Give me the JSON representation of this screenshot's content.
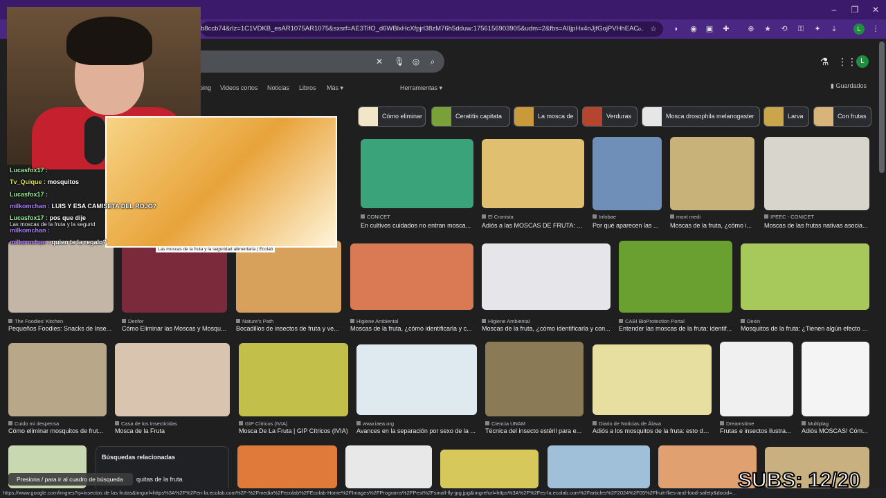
{
  "browser": {
    "url": "b8ccb74&rlz=1C1VDKB_esAR1075AR1075&sxsrf=AE3TifO_d6WBlxHcXfpjrl38zM76h5dduw:1756156903905&udm=2&fbs=AIIjpHx4nJjfGojPVHhEAC...",
    "status_url": "https://www.google.com/imgres?q=insectos de las frutas&imgurl=https%3A%2F%2Fen-la.ecolab.com%2F-%2Fmedia%2Fecolab%2FEcolab-Home%2FImages%2FPrograms%2FPest%2Fsmall-fly-jpg.jpg&imgrefurl=https%3A%2F%2Fes-la.ecolab.com%2Farticles%2F2024%2F05%2Ffruit-flies-and-food-safety&docid=...",
    "profile_letter": "L"
  },
  "google": {
    "avatar_letter": "L",
    "tabs": [
      "ping",
      "Videos cortos",
      "Noticias",
      "Libros",
      "Más ▾",
      "Herramientas ▾"
    ],
    "saved_label": "Guardados"
  },
  "chips": [
    {
      "label": "Cómo eliminar",
      "color": "#f1e7c8"
    },
    {
      "label": "Ceratitis capitata",
      "color": "#7aa03a"
    },
    {
      "label": "La mosca de",
      "color": "#c99a3b"
    },
    {
      "label": "Verduras",
      "color": "#b5452f"
    },
    {
      "label": "Mosca drosophila melanogaster",
      "color": "#e6e6e6"
    },
    {
      "label": "Larva",
      "color": "#caa54a"
    },
    {
      "label": "Con frutas",
      "color": "#d9b47a"
    }
  ],
  "results": [
    {
      "source": "CONICET",
      "title": "En cultivos cuidados no entran mosca...",
      "color": "#3aa37a"
    },
    {
      "source": "El Cronista",
      "title": "Adiós a las MOSCAS DE FRUTA: ...",
      "color": "#e0c070"
    },
    {
      "source": "Infobae",
      "title": "Por qué aparecen las ...",
      "color": "#6f8fb8"
    },
    {
      "source": "mont medi",
      "title": "Moscas de la fruta, ¿cómo i...",
      "color": "#c9b27a"
    },
    {
      "source": "IPEEC - CONICET",
      "title": "Moscas de las frutas nativas asocia...",
      "color": "#d8d6cc"
    },
    {
      "source": "The Foodies' Kitchen",
      "title": "Pequeños Foodies: Snacks de Inse...",
      "color": "#c4b6a6"
    },
    {
      "source": "Denfor",
      "title": "Cómo Eliminar las Moscas y Mosqu...",
      "color": "#7a2a3a"
    },
    {
      "source": "Nature's Path",
      "title": "Bocadillos de insectos de fruta y ve...",
      "color": "#d7a15b"
    },
    {
      "source": "Higiene Ambiental",
      "title": "Moscas de la fruta, ¿cómo identificarla y c...",
      "color": "#d97a55"
    },
    {
      "source": "Higiene Ambiental",
      "title": "Moscas de la fruta, ¿cómo identificarla y con...",
      "color": "#e6e6ea"
    },
    {
      "source": "CABI BioProtection Portal",
      "title": "Entender las moscas de la fruta: identif...",
      "color": "#6aa030"
    },
    {
      "source": "Dexin",
      "title": "Mosquitos de la fruta: ¿Tienen algún efecto s...",
      "color": "#a7c85a"
    },
    {
      "source": "Cuido mi despensa",
      "title": "Cómo eliminar mosquitos de frut...",
      "color": "#b9a78a"
    },
    {
      "source": "Casa de los Insecticidas",
      "title": "Mosca de la Fruta",
      "color": "#d9c4b0"
    },
    {
      "source": "GIP Cítricos (IVIA)",
      "title": "Mosca De La Fruta | GIP Cítricos (IVIA)",
      "color": "#c2c04a"
    },
    {
      "source": "www.iaea.org",
      "title": "Avances en la separación por sexo de la ...",
      "color": "#dfeaf0"
    },
    {
      "source": "Ciencia UNAM",
      "title": "Técnica del insecto estéril para e...",
      "color": "#8a7a55"
    },
    {
      "source": "Diario de Noticias de Álava",
      "title": "Adiós a los mosquitos de la fruta: esto de...",
      "color": "#e6dfa0"
    },
    {
      "source": "Dreamstime",
      "title": "Frutas e insectos ilustra...",
      "color": "#f0f0f0"
    },
    {
      "source": "Multiplag",
      "title": "Adiós MOSCAS! Cóm...",
      "color": "#f4f4f4"
    }
  ],
  "related": {
    "title": "Búsquedas relacionadas",
    "item": "quitas de la fruta"
  },
  "overlay": {
    "preview_caption": "Las moscas de la fruta y la seguridad alimentaria | Ecolab",
    "chat": [
      {
        "user": "Lucasfox17 :",
        "msg": ""
      },
      {
        "user": "Tv_Quique :",
        "msg": "mosquitos"
      },
      {
        "user": "Lucasfox17 :",
        "msg": ""
      },
      {
        "user": "milkomchan :",
        "msg": "LUIS Y ESA CAMISETA DEL ROJO?"
      },
      {
        "user": "Lucasfox17 :",
        "msg": "pos que dije"
      },
      {
        "user": "milkomchan :",
        "msg": ""
      },
      {
        "user": "milkomchan :",
        "msg": "quien te la regalo?"
      }
    ],
    "behind_text": "Las moscas de la fruta y la segurid",
    "tip": "Presiona / para ir al cuadro de búsqueda",
    "subs": "SUBS: 12/20"
  }
}
